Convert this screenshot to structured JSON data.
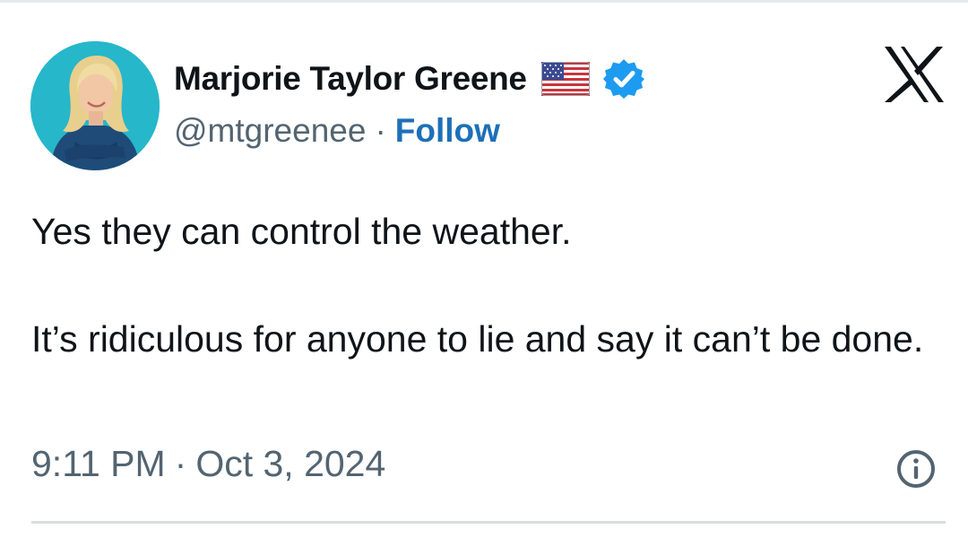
{
  "author": {
    "display_name": "Marjorie Taylor Greene",
    "handle": "@mtgreenee",
    "separator": "·",
    "follow_label": "Follow",
    "flag_icon": "us-flag-icon",
    "verified_icon": "verified-badge-icon"
  },
  "platform": {
    "logo_icon": "x-logo-icon"
  },
  "post": {
    "paragraphs": [
      "Yes they can control the weather.",
      "It’s ridiculous for anyone to lie and say it can’t be done."
    ]
  },
  "meta": {
    "time": "9:11 PM",
    "separator": "·",
    "date": "Oct 3, 2024",
    "info_icon": "info-icon"
  },
  "colors": {
    "text": "#0f1419",
    "secondary": "#536471",
    "link": "#1d70b8",
    "verified": "#1d9bf0",
    "avatar_bg": "#24b6c8"
  }
}
